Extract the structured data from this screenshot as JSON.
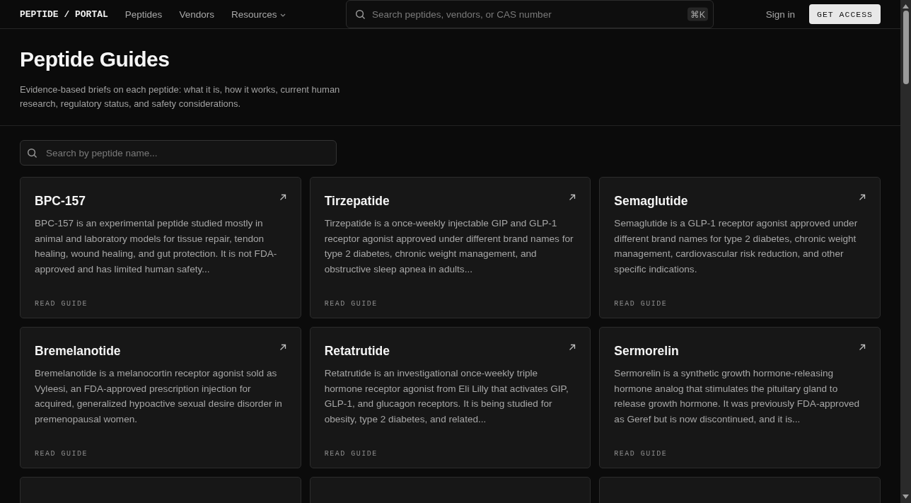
{
  "nav": {
    "logo": "PEPTIDE / PORTAL",
    "links": [
      {
        "label": "Peptides",
        "kind": "link"
      },
      {
        "label": "Vendors",
        "kind": "link"
      },
      {
        "label": "Resources",
        "kind": "menu"
      }
    ],
    "search": {
      "placeholder": "Search peptides, vendors, or CAS number",
      "shortcut": "⌘K"
    },
    "sign_in": "Sign in",
    "cta": "GET ACCESS"
  },
  "header": {
    "title": "Peptide Guides",
    "subtitle": "Evidence-based briefs on each peptide: what it is, how it works, current human research, regulatory status, and safety considerations."
  },
  "filter": {
    "placeholder": "Search by peptide name..."
  },
  "cards": [
    {
      "kind": "guide",
      "title": "BPC-157",
      "summary": "BPC-157 is an experimental peptide studied mostly in animal and laboratory models for tissue repair, tendon healing, wound healing, and gut protection. It is not FDA-approved and has limited human safety...",
      "link": "READ GUIDE"
    },
    {
      "kind": "guide",
      "title": "Tirzepatide",
      "summary": "Tirzepatide is a once-weekly injectable GIP and GLP-1 receptor agonist approved under different brand names for type 2 diabetes, chronic weight management, and obstructive sleep apnea in adults...",
      "link": "READ GUIDE"
    },
    {
      "kind": "guide",
      "title": "Semaglutide",
      "summary": "Semaglutide is a GLP-1 receptor agonist approved under different brand names for type 2 diabetes, chronic weight management, cardiovascular risk reduction, and other specific indications.",
      "link": "READ GUIDE"
    },
    {
      "kind": "guide",
      "title": "Bremelanotide",
      "summary": "Bremelanotide is a melanocortin receptor agonist sold as Vyleesi, an FDA-approved prescription injection for acquired, generalized hypoactive sexual desire disorder in premenopausal women.",
      "link": "READ GUIDE"
    },
    {
      "kind": "guide",
      "title": "Retatrutide",
      "summary": "Retatrutide is an investigational once-weekly triple hormone receptor agonist from Eli Lilly that activates GIP, GLP-1, and glucagon receptors. It is being studied for obesity, type 2 diabetes, and related...",
      "link": "READ GUIDE"
    },
    {
      "kind": "guide",
      "title": "Sermorelin",
      "summary": "Sermorelin is a synthetic growth hormone-releasing hormone analog that stimulates the pituitary gland to release growth hormone. It was previously FDA-approved as Geref but is now discontinued, and it is...",
      "link": "READ GUIDE"
    },
    {
      "kind": "cut"
    },
    {
      "kind": "cut"
    },
    {
      "kind": "cut"
    }
  ]
}
